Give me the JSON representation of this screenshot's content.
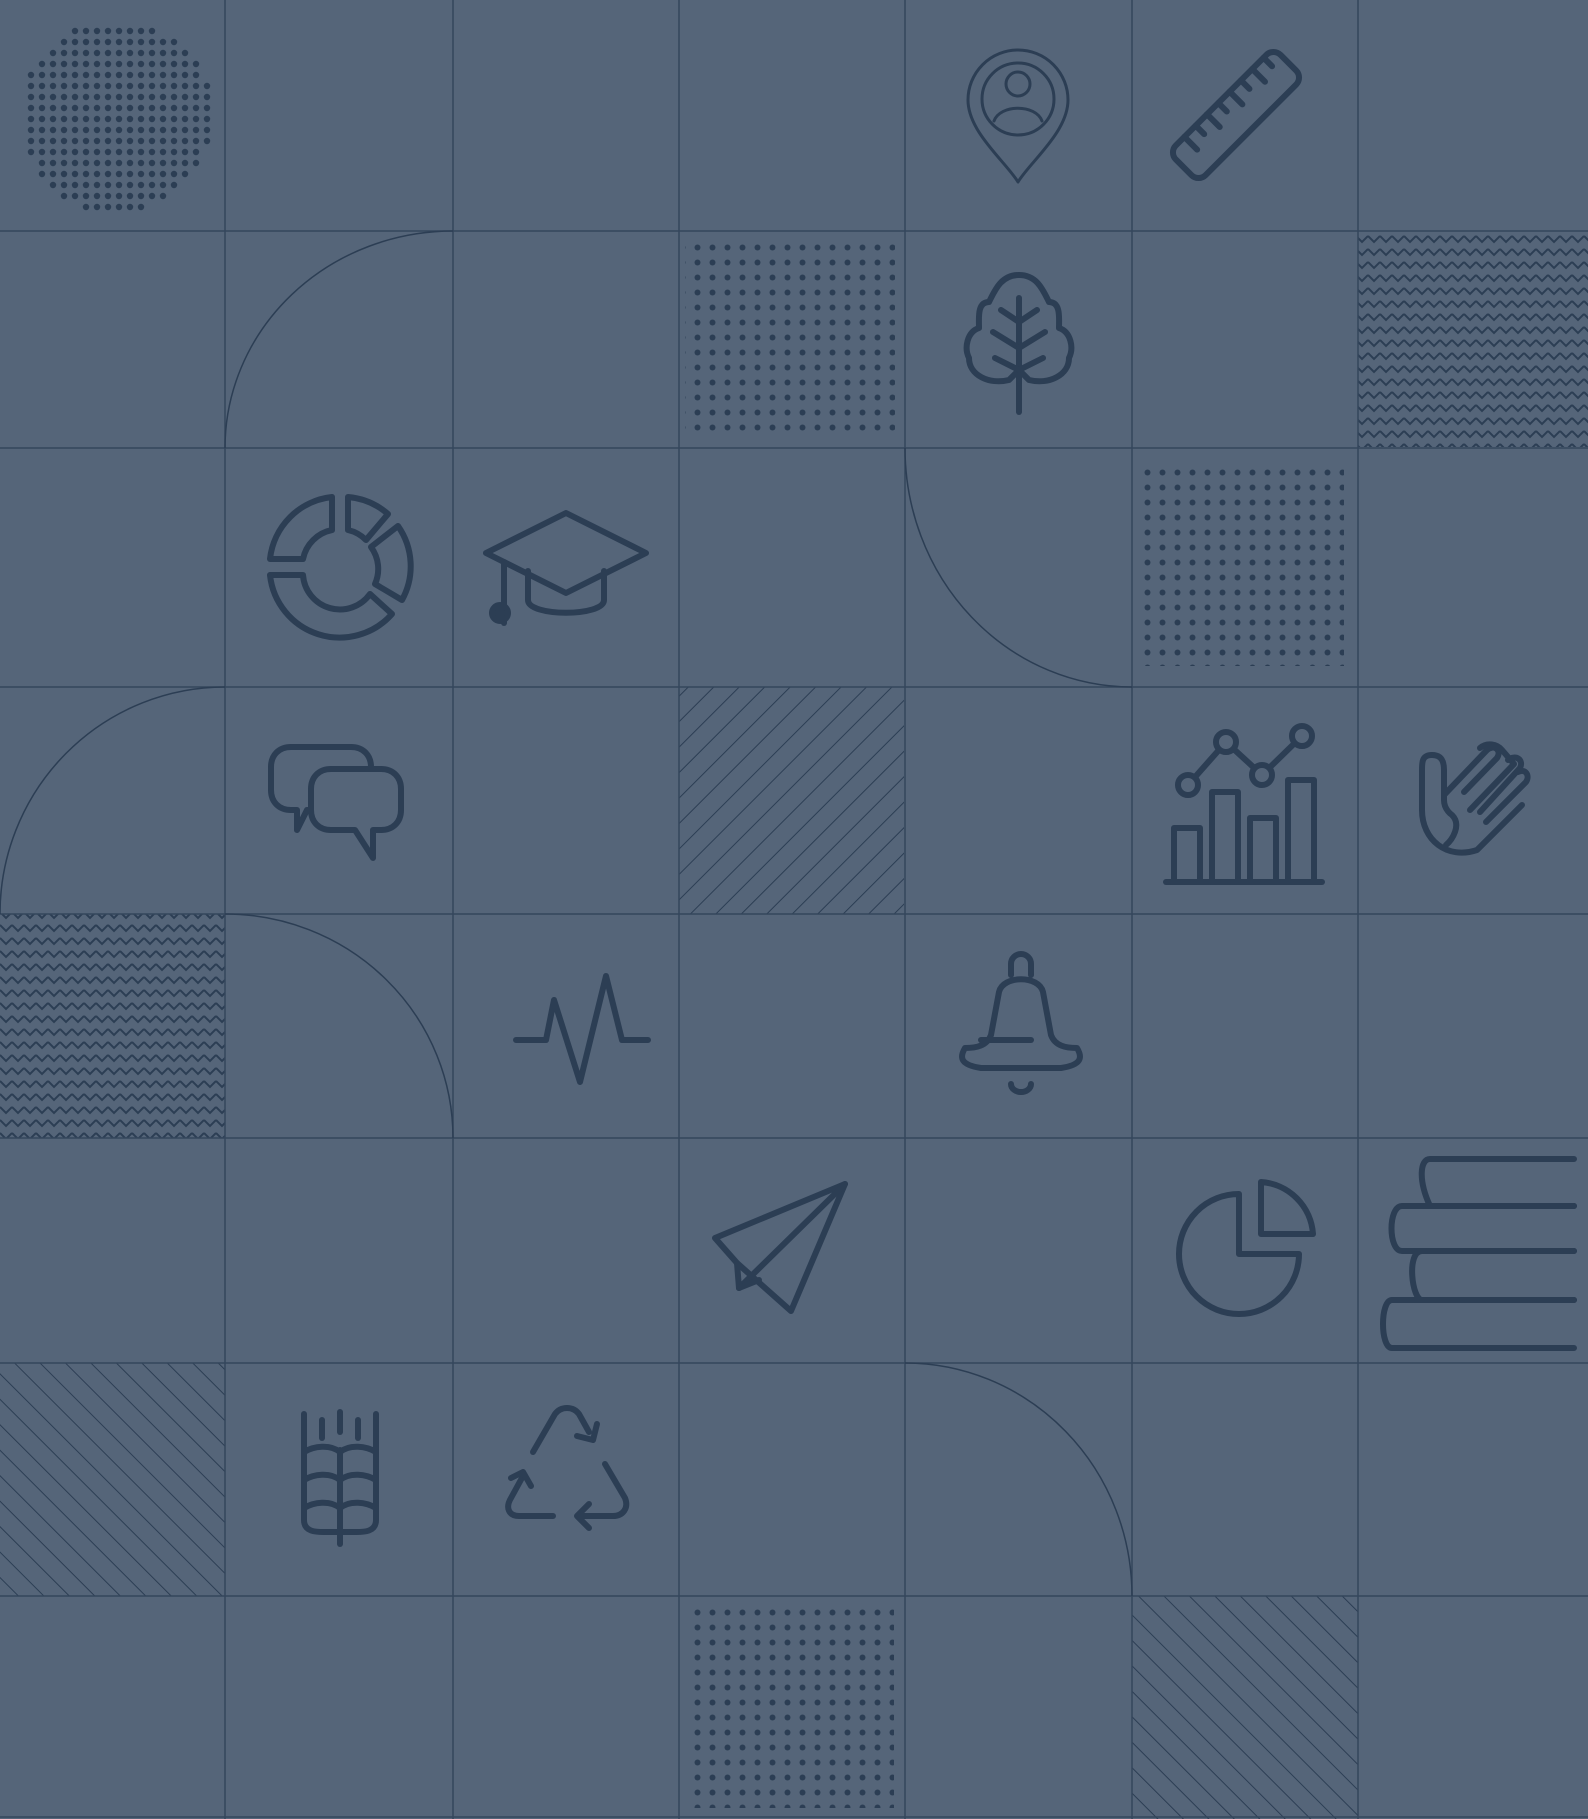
{
  "palette": {
    "background": "#556579",
    "line": "#2c3e54",
    "grid": "#34465c"
  },
  "icons": [
    "location-user-pin-icon",
    "ruler-icon",
    "leaf-icon",
    "donut-chart-icon",
    "graduation-cap-icon",
    "chat-bubbles-icon",
    "bar-line-chart-icon",
    "waving-hand-icon",
    "pulse-icon",
    "bell-icon",
    "paper-plane-icon",
    "pie-chart-icon",
    "book-stack-icon",
    "wheat-icon",
    "recycle-icon"
  ],
  "patterns": [
    "halftone-circle",
    "dot-grid",
    "zigzag",
    "diagonal-hatch",
    "quarter-arc"
  ]
}
